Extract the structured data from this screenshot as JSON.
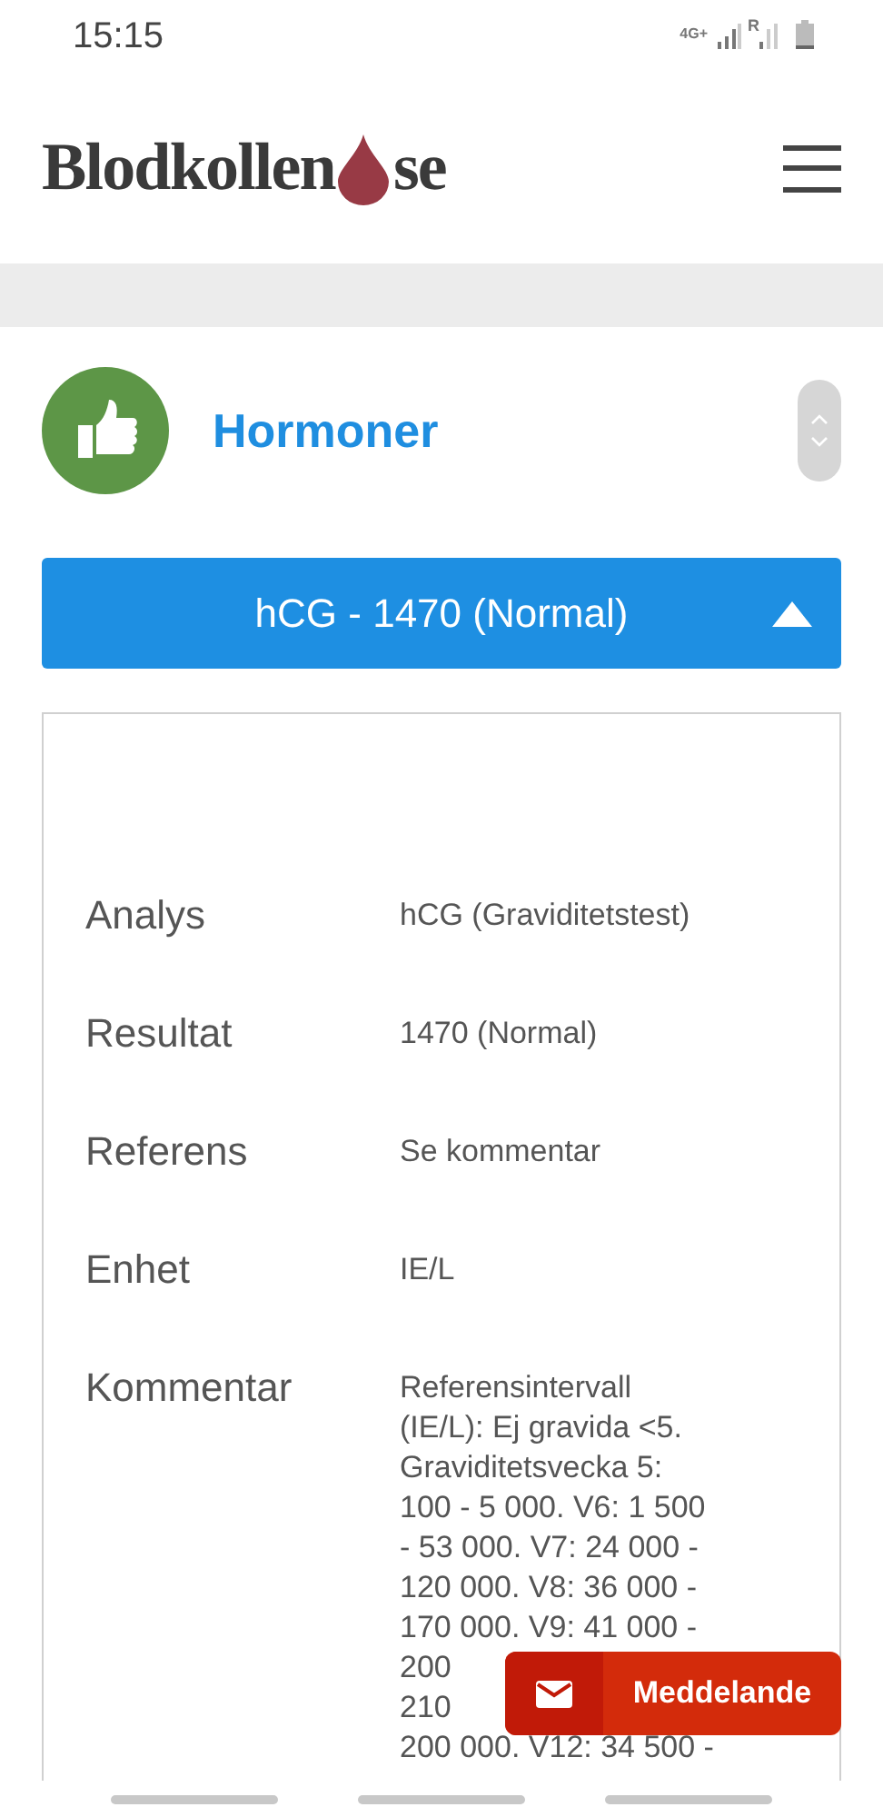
{
  "status_bar": {
    "time": "15:15",
    "network": "4G+",
    "roaming": "R"
  },
  "header": {
    "logo_left": "Blodkollen",
    "logo_right": "se"
  },
  "category": {
    "title": "Hormoner"
  },
  "accordion": {
    "label": "hCG - 1470 (Normal)",
    "expanded": true
  },
  "details": [
    {
      "label": "Analys",
      "value": "hCG (Graviditetstest)"
    },
    {
      "label": "Resultat",
      "value": "1470 (Normal)"
    },
    {
      "label": "Referens",
      "value": "Se kommentar"
    },
    {
      "label": "Enhet",
      "value": "IE/L"
    }
  ],
  "comment": {
    "label": "Kommentar",
    "lines": [
      "Referensintervall",
      "(IE/L): Ej gravida <5.",
      "Graviditetsvecka 5:",
      "100 - 5 000. V6: 1 500",
      "- 53 000. V7: 24 000 -",
      "120 000. V8: 36 000 -",
      "170 000. V9: 41 000 -",
      "200",
      "210",
      "200 000. V12: 34 500 -"
    ]
  },
  "message_button": {
    "label": "Meddelande"
  }
}
